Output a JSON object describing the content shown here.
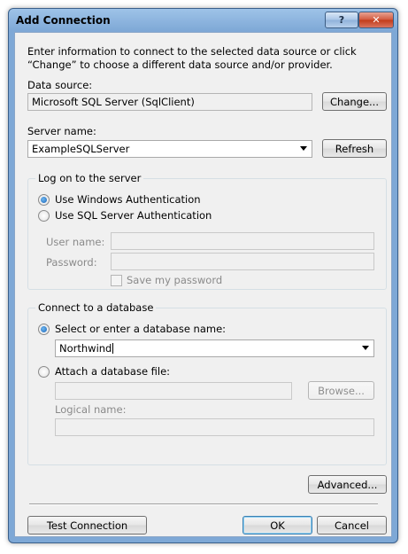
{
  "window": {
    "title": "Add Connection",
    "help_label": "?",
    "close_label": "✕"
  },
  "intro_text": "Enter information to connect to the selected data source or click “Change” to choose a different data source and/or provider.",
  "data_source": {
    "label": "Data source:",
    "value": "Microsoft SQL Server (SqlClient)",
    "change_label": "Change..."
  },
  "server": {
    "label": "Server name:",
    "value": "ExampleSQLServer",
    "refresh_label": "Refresh"
  },
  "logon": {
    "title": "Log on to the server",
    "windows_auth": "Use Windows Authentication",
    "sql_auth": "Use SQL Server Authentication",
    "selected": "windows",
    "user_name_label": "User name:",
    "user_name_value": "",
    "password_label": "Password:",
    "password_value": "",
    "save_password_label": "Save my password"
  },
  "database": {
    "title": "Connect to a database",
    "select_label": "Select or enter a database name:",
    "database_name": "Northwind",
    "attach_label": "Attach a database file:",
    "attach_value": "",
    "browse_label": "Browse...",
    "logical_name_label": "Logical name:",
    "logical_name_value": "",
    "selected": "select"
  },
  "advanced_label": "Advanced...",
  "footer": {
    "test_label": "Test Connection",
    "ok_label": "OK",
    "cancel_label": "Cancel"
  },
  "icons": {
    "radio": "radio-button",
    "checkbox": "checkbox",
    "dropdown": "chevron-down-icon"
  },
  "colors": {
    "titlebar": "#7ea8d6",
    "client_bg": "#f0f0f0",
    "close_button": "#c23a18",
    "radio_selected": "#1a64b8"
  }
}
